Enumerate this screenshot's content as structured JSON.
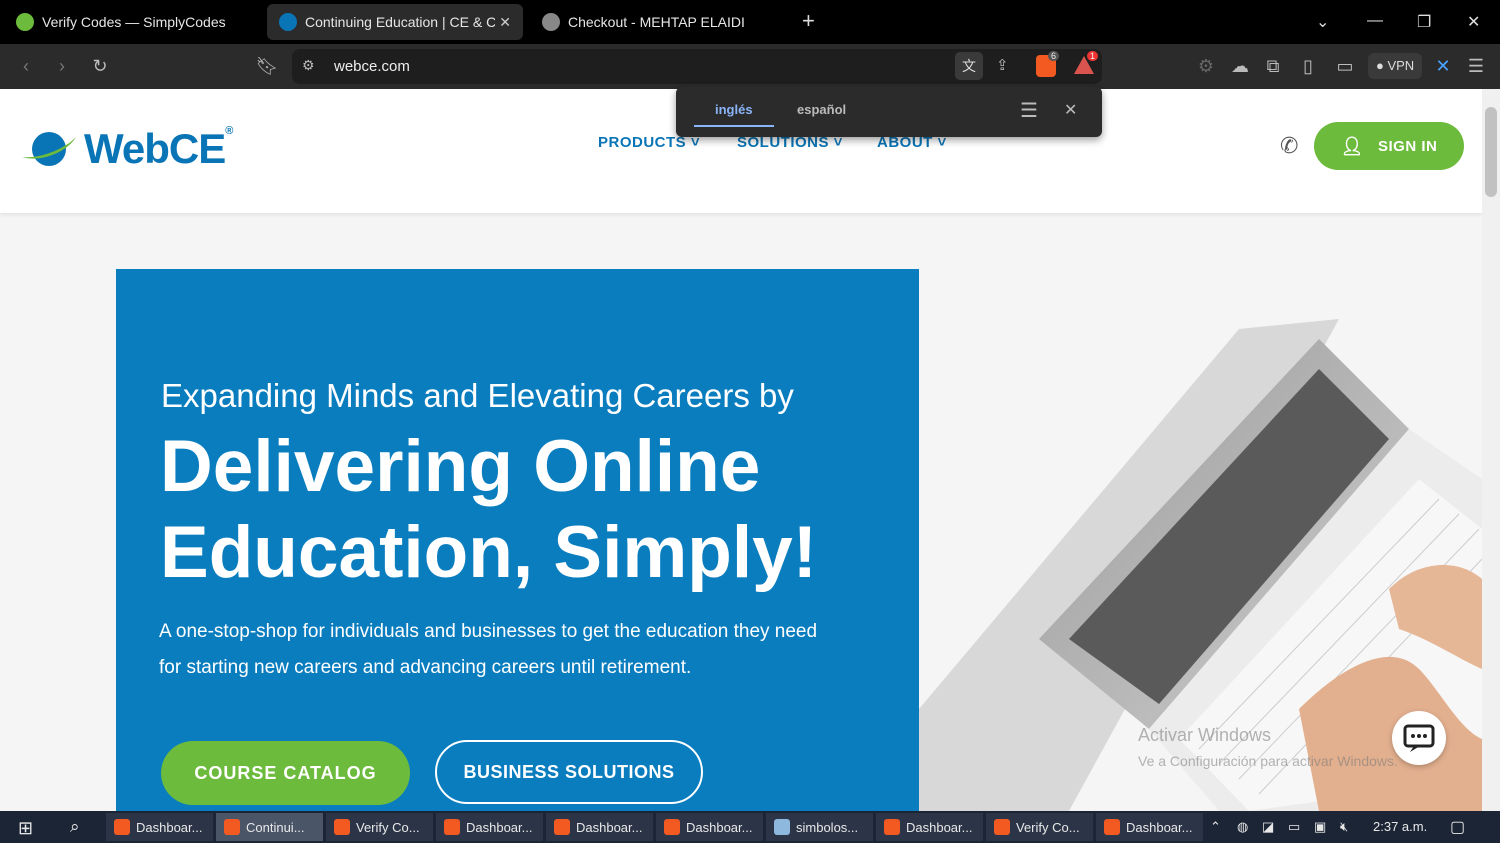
{
  "tabs": [
    {
      "title": "Verify Codes — SimplyCodes",
      "active": false
    },
    {
      "title": "Continuing Education | CE & CPE",
      "active": true
    },
    {
      "title": "Checkout - MEHTAP ELAIDI",
      "active": false
    }
  ],
  "new_tab_label": "+",
  "window": {
    "minimize": "—",
    "maximize": "❐",
    "close": "✕",
    "tab_list": "⌄"
  },
  "toolbar": {
    "url": "webce.com",
    "vpn_label": "VPN",
    "brave_badge": "6",
    "rewards_badge": "1"
  },
  "translate_popup": {
    "source_lang": "inglés",
    "target_lang": "español"
  },
  "site": {
    "logo_text": "WebCE",
    "logo_reg": "®",
    "nav": [
      {
        "label": "PRODUCTS ˅"
      },
      {
        "label": "SOLUTIONS ˅"
      },
      {
        "label": "ABOUT ˅"
      }
    ],
    "sign_in": "SIGN IN"
  },
  "hero": {
    "eyebrow": "Expanding Minds and Elevating Careers by",
    "headline": "Delivering Online Education, Simply!",
    "description": "A one-stop-shop for individuals and businesses to get the education they need for starting new careers and advancing careers until retirement.",
    "cta_primary": "COURSE CATALOG",
    "cta_secondary": "BUSINESS SOLUTIONS"
  },
  "watermark": {
    "line1": "Activar Windows",
    "line2": "Ve a Configuración para activar Windows."
  },
  "taskbar": {
    "items": [
      {
        "label": "Dashboar...",
        "active": false
      },
      {
        "label": "Continui...",
        "active": true
      },
      {
        "label": "Verify Co...",
        "active": false
      },
      {
        "label": "Dashboar...",
        "active": false
      },
      {
        "label": "Dashboar...",
        "active": false
      },
      {
        "label": "Dashboar...",
        "active": false
      },
      {
        "label": "simbolos...",
        "active": false
      },
      {
        "label": "Dashboar...",
        "active": false
      },
      {
        "label": "Verify Co...",
        "active": false
      },
      {
        "label": "Dashboar...",
        "active": false
      }
    ],
    "clock": "2:37 a.m."
  },
  "colors": {
    "brand_blue": "#0a7dbf",
    "brand_green": "#6cbb3c",
    "browser_dark": "#2b2b2b"
  }
}
